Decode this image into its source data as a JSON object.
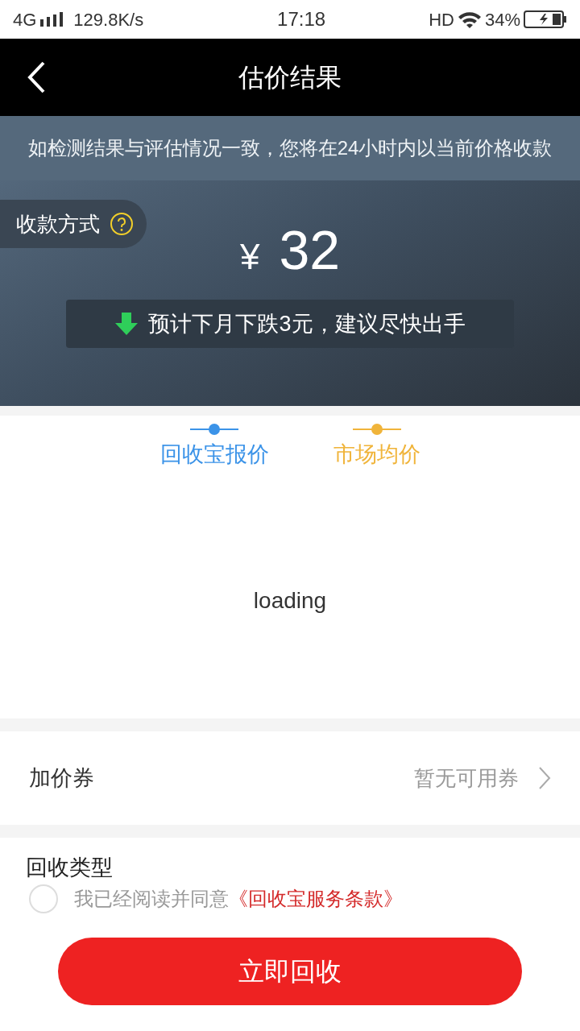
{
  "status_bar": {
    "network": "4G",
    "speed": "129.8K/s",
    "time": "17:18",
    "hd": "HD",
    "battery": "34%"
  },
  "header": {
    "title": "估价结果"
  },
  "notice": "如检测结果与评估情况一致，您将在24小时内以当前价格收款",
  "payment_method": {
    "label": "收款方式"
  },
  "price": {
    "currency": "¥",
    "amount": "32"
  },
  "trend": {
    "kind": "down",
    "text": "预计下月下跌3元，建议尽快出手"
  },
  "chart": {
    "legend": [
      {
        "label": "回收宝报价",
        "color": "#3b93e8"
      },
      {
        "label": "市场均价",
        "color": "#f0b43a"
      }
    ],
    "status": "loading"
  },
  "coupon": {
    "label": "加价券",
    "value": "暂无可用券"
  },
  "recycle_type": {
    "label": "回收类型"
  },
  "agreement": {
    "checked": false,
    "text": "我已经阅读并同意",
    "link": "《回收宝服务条款》"
  },
  "submit": {
    "label": "立即回收"
  }
}
